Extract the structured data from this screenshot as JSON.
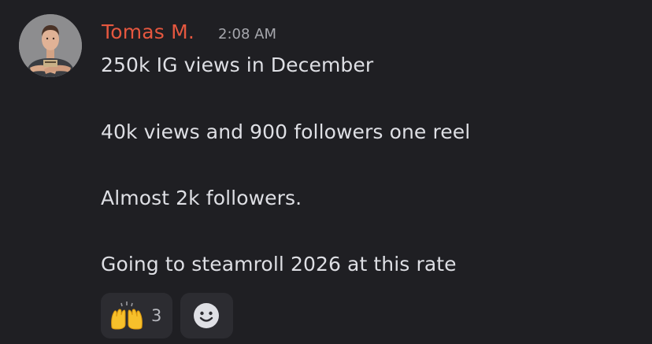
{
  "message": {
    "author": "Tomas M.",
    "timestamp": "2:08 AM",
    "lines": [
      "250k IG views in December",
      "40k views and 900 followers one reel",
      "Almost 2k followers.",
      "Going to steamroll 2026 at this rate"
    ],
    "author_color": "#e5573f"
  },
  "reactions": [
    {
      "emoji": "raising-hands-icon",
      "count": "3"
    }
  ],
  "add_reaction": {
    "icon": "smiley-icon"
  }
}
